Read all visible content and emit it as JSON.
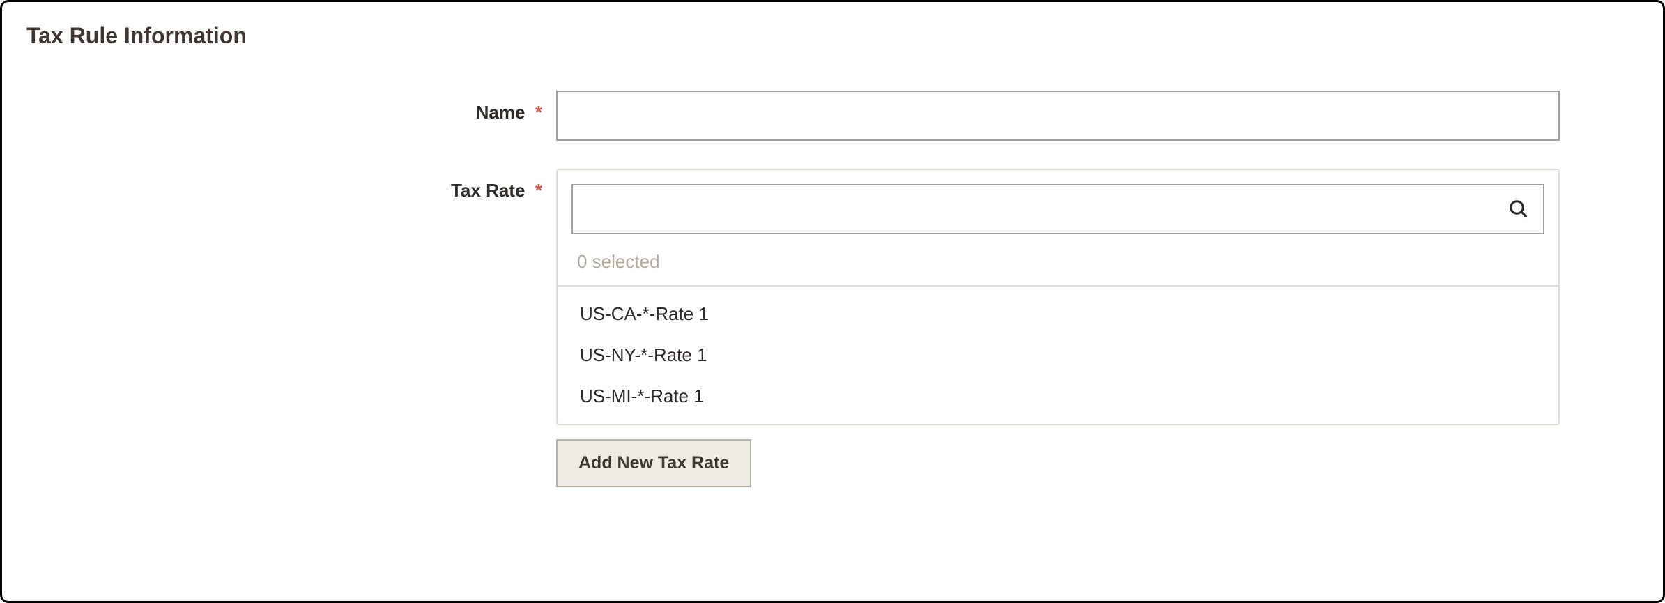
{
  "panel": {
    "title": "Tax Rule Information"
  },
  "form": {
    "name": {
      "label": "Name",
      "value": ""
    },
    "tax_rate": {
      "label": "Tax Rate",
      "search_value": "",
      "selected_text": "0 selected",
      "options": [
        "US-CA-*-Rate 1",
        "US-NY-*-Rate 1",
        "US-MI-*-Rate 1"
      ],
      "add_button": "Add New Tax Rate"
    }
  }
}
